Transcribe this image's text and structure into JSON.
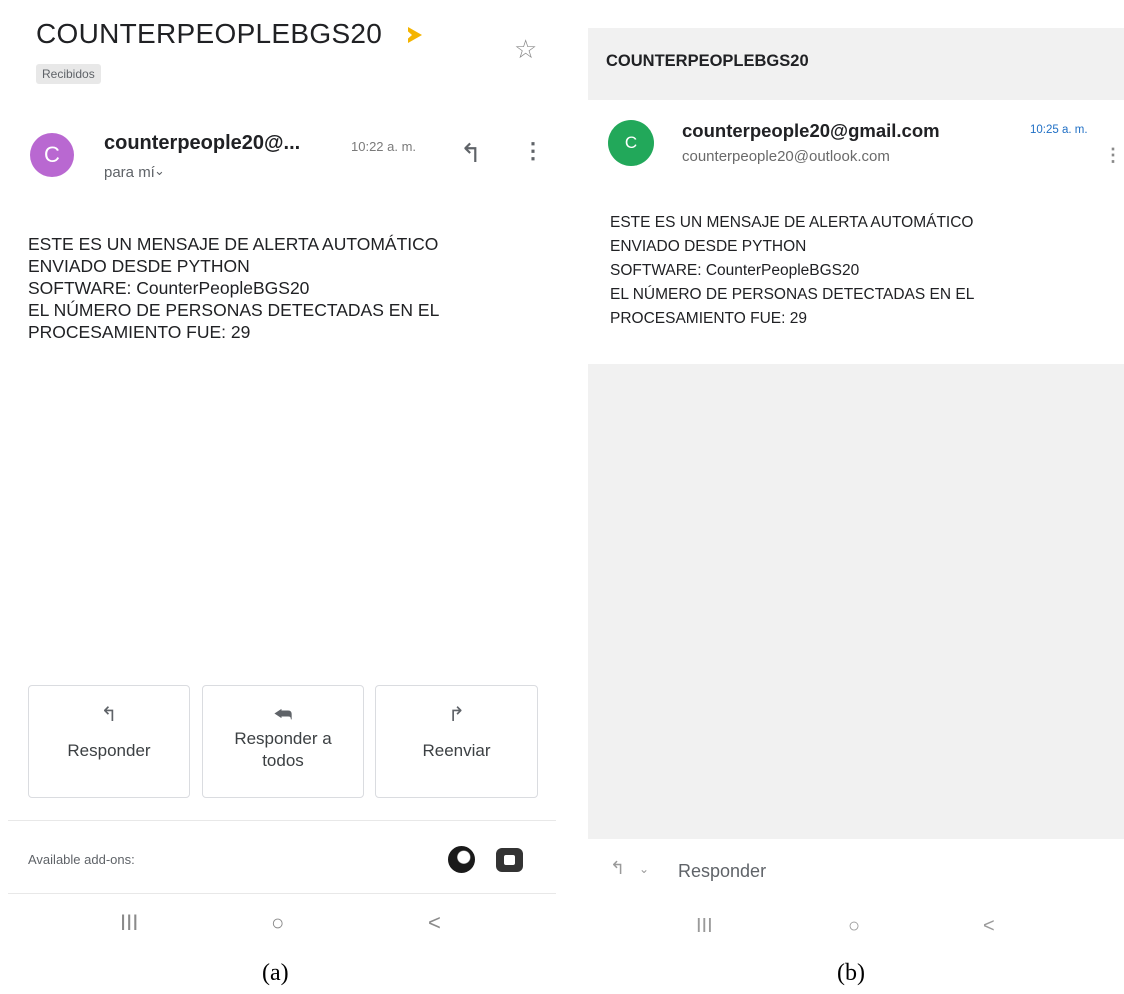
{
  "panel_a": {
    "title": "COUNTERPEOPLEBGS20",
    "label_chip": "Recibidos",
    "avatar_letter": "C",
    "sender": "counterpeople20@...",
    "time": "10:22 a. m.",
    "recipient": "para mí",
    "body_lines": [
      "ESTE ES UN MENSAJE DE ALERTA AUTOMÁTICO",
      "ENVIADO DESDE PYTHON",
      "SOFTWARE: CounterPeopleBGS20",
      "EL NÚMERO DE PERSONAS DETECTADAS EN EL",
      "PROCESAMIENTO FUE: 29"
    ],
    "actions": {
      "reply": "Responder",
      "reply_all_line1": "Responder a",
      "reply_all_line2": "todos",
      "forward": "Reenviar"
    },
    "addons_label": "Available add-ons:",
    "icons": {
      "important": "important-marker-icon",
      "star": "star-icon",
      "reply": "reply-icon",
      "more": "more-vert-icon",
      "reply_all": "reply-all-icon",
      "forward": "forward-icon",
      "addon1": "addon-circle-icon",
      "addon2": "video-call-icon"
    },
    "colors": {
      "avatar": "#b968d1",
      "important": "#f4b400"
    }
  },
  "panel_b": {
    "title": "COUNTERPEOPLEBGS20",
    "avatar_letter": "C",
    "sender": "counterpeople20@gmail.com",
    "recipient_email": "counterpeople20@outlook.com",
    "time": "10:25 a. m.",
    "body_lines": [
      "ESTE ES UN MENSAJE DE ALERTA AUTOMÁTICO",
      "ENVIADO DESDE PYTHON",
      "SOFTWARE: CounterPeopleBGS20",
      "EL NÚMERO DE PERSONAS DETECTADAS EN EL",
      "PROCESAMIENTO FUE: 29"
    ],
    "reply_label": "Responder",
    "colors": {
      "avatar": "#22a85a",
      "time": "#1f6fc5"
    }
  },
  "nav": {
    "recent": "III",
    "home": "○",
    "back": "<"
  },
  "captions": {
    "a": "(a)",
    "b": "(b)"
  }
}
